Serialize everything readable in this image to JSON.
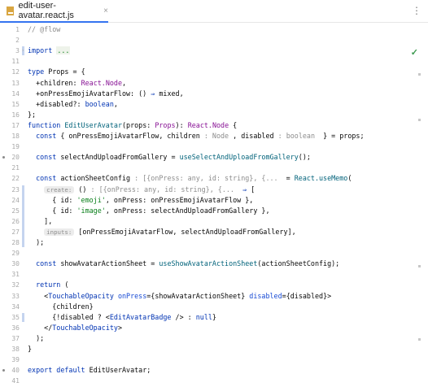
{
  "tab": {
    "filename": "edit-user-avatar.react.js",
    "close": "×",
    "more": "⋮"
  },
  "status": {
    "check": "✓"
  },
  "lines": [
    {
      "n": "1"
    },
    {
      "n": "2"
    },
    {
      "n": "3"
    },
    {
      "n": "11"
    },
    {
      "n": "12"
    },
    {
      "n": "13"
    },
    {
      "n": "14"
    },
    {
      "n": "15"
    },
    {
      "n": "16"
    },
    {
      "n": "17"
    },
    {
      "n": "18"
    },
    {
      "n": "19"
    },
    {
      "n": "20"
    },
    {
      "n": "21"
    },
    {
      "n": "22"
    },
    {
      "n": "23"
    },
    {
      "n": "24"
    },
    {
      "n": "25"
    },
    {
      "n": "26"
    },
    {
      "n": "27"
    },
    {
      "n": "28"
    },
    {
      "n": "29"
    },
    {
      "n": "30"
    },
    {
      "n": "31"
    },
    {
      "n": "32"
    },
    {
      "n": "33"
    },
    {
      "n": "34"
    },
    {
      "n": "35"
    },
    {
      "n": "36"
    },
    {
      "n": "37"
    },
    {
      "n": "38"
    },
    {
      "n": "39"
    },
    {
      "n": "40"
    },
    {
      "n": "41"
    }
  ],
  "code": {
    "l1": "// @flow",
    "l3_kw": "import",
    "l3_fold": "...",
    "l12_kw": "type",
    "l12_name": "Props",
    "l12_rest": " = {",
    "l13_a": "  +children: ",
    "l13_b": "React.Node",
    "l13_c": ",",
    "l14_a": "  +onPressEmojiAvatarFlow: () ",
    "l14_arrow": "⇒",
    "l14_b": " mixed,",
    "l15_a": "  +disabled?: ",
    "l15_b": "boolean",
    "l15_c": ",",
    "l16": "};",
    "l17_kw": "function",
    "l17_fn": "EditUserAvatar",
    "l17_a": "(props: ",
    "l17_ty": "Props",
    "l17_b": "): ",
    "l17_ty2": "React.Node",
    "l17_c": " {",
    "l18_kw": "  const",
    "l18_a": " { onPressEmojiAvatarFlow, children ",
    "l18_h1": ": Node",
    "l18_b": " , disabled ",
    "l18_h2": ": boolean",
    "l18_c": "  } = props;",
    "l20_kw": "  const",
    "l20_a": " selectAndUploadFromGallery = ",
    "l20_fn": "useSelectAndUploadFromGallery",
    "l20_b": "();",
    "l22_kw": "  const",
    "l22_a": " actionSheetConfig ",
    "l22_h": ": [{onPress: any, id: string}, {...",
    "l22_b": "  = ",
    "l22_fn": "React.useMemo",
    "l22_c": "(",
    "l23_inlay": "create:",
    "l23_a": " () ",
    "l23_h": ": [{onPress: any, id: string}, {...",
    "l23_arrow": "  ⇒",
    "l23_b": " [",
    "l24_a": "      { id: ",
    "l24_str": "'emoji'",
    "l24_b": ", onPress: onPressEmojiAvatarFlow },",
    "l25_a": "      { id: ",
    "l25_str": "'image'",
    "l25_b": ", onPress: selectAndUploadFromGallery },",
    "l26": "    ],",
    "l27_inlay": "inputs:",
    "l27_a": " [onPressEmojiAvatarFlow, selectAndUploadFromGallery],",
    "l28": "  );",
    "l30_kw": "  const",
    "l30_a": " showAvatarActionSheet = ",
    "l30_fn": "useShowAvatarActionSheet",
    "l30_b": "(actionSheetConfig);",
    "l32_kw": "  return",
    "l32_a": " (",
    "l33_a": "    <",
    "l33_tag": "TouchableOpacity",
    "l33_attr1": " onPress",
    "l33_b": "={showAvatarActionSheet}",
    "l33_attr2": " disabled",
    "l33_c": "={disabled}>",
    "l34": "      {children}",
    "l35_a": "      {!disabled ? <",
    "l35_tag": "EditAvatarBadge",
    "l35_b": " /> : ",
    "l35_kw": "null",
    "l35_c": "}",
    "l36_a": "    </",
    "l36_tag": "TouchableOpacity",
    "l36_b": ">",
    "l37": "  );",
    "l38": "}",
    "l40_kw1": "export",
    "l40_kw2": " default",
    "l40_a": " EditUserAvatar;"
  }
}
